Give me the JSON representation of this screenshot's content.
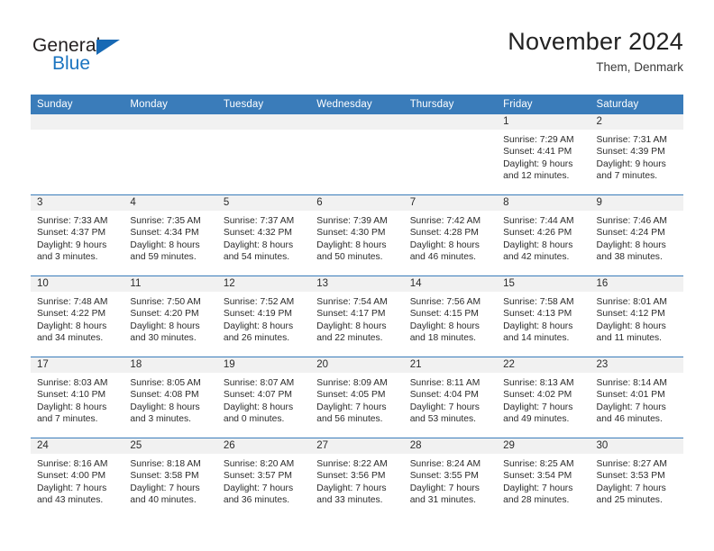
{
  "brand": {
    "name_part1": "General",
    "name_part2": "Blue",
    "accent_color": "#1b74c0",
    "triangle_icon": "triangle-icon"
  },
  "header": {
    "title": "November 2024",
    "subtitle": "Them, Denmark"
  },
  "calendar": {
    "header_bg": "#3a7cba",
    "daynum_bg": "#f1f1f1",
    "weekday_headers": [
      "Sunday",
      "Monday",
      "Tuesday",
      "Wednesday",
      "Thursday",
      "Friday",
      "Saturday"
    ],
    "weeks": [
      [
        {
          "day": "",
          "sunrise": "",
          "sunset": "",
          "daylight_line1": "",
          "daylight_line2": ""
        },
        {
          "day": "",
          "sunrise": "",
          "sunset": "",
          "daylight_line1": "",
          "daylight_line2": ""
        },
        {
          "day": "",
          "sunrise": "",
          "sunset": "",
          "daylight_line1": "",
          "daylight_line2": ""
        },
        {
          "day": "",
          "sunrise": "",
          "sunset": "",
          "daylight_line1": "",
          "daylight_line2": ""
        },
        {
          "day": "",
          "sunrise": "",
          "sunset": "",
          "daylight_line1": "",
          "daylight_line2": ""
        },
        {
          "day": "1",
          "sunrise": "Sunrise: 7:29 AM",
          "sunset": "Sunset: 4:41 PM",
          "daylight_line1": "Daylight: 9 hours",
          "daylight_line2": "and 12 minutes."
        },
        {
          "day": "2",
          "sunrise": "Sunrise: 7:31 AM",
          "sunset": "Sunset: 4:39 PM",
          "daylight_line1": "Daylight: 9 hours",
          "daylight_line2": "and 7 minutes."
        }
      ],
      [
        {
          "day": "3",
          "sunrise": "Sunrise: 7:33 AM",
          "sunset": "Sunset: 4:37 PM",
          "daylight_line1": "Daylight: 9 hours",
          "daylight_line2": "and 3 minutes."
        },
        {
          "day": "4",
          "sunrise": "Sunrise: 7:35 AM",
          "sunset": "Sunset: 4:34 PM",
          "daylight_line1": "Daylight: 8 hours",
          "daylight_line2": "and 59 minutes."
        },
        {
          "day": "5",
          "sunrise": "Sunrise: 7:37 AM",
          "sunset": "Sunset: 4:32 PM",
          "daylight_line1": "Daylight: 8 hours",
          "daylight_line2": "and 54 minutes."
        },
        {
          "day": "6",
          "sunrise": "Sunrise: 7:39 AM",
          "sunset": "Sunset: 4:30 PM",
          "daylight_line1": "Daylight: 8 hours",
          "daylight_line2": "and 50 minutes."
        },
        {
          "day": "7",
          "sunrise": "Sunrise: 7:42 AM",
          "sunset": "Sunset: 4:28 PM",
          "daylight_line1": "Daylight: 8 hours",
          "daylight_line2": "and 46 minutes."
        },
        {
          "day": "8",
          "sunrise": "Sunrise: 7:44 AM",
          "sunset": "Sunset: 4:26 PM",
          "daylight_line1": "Daylight: 8 hours",
          "daylight_line2": "and 42 minutes."
        },
        {
          "day": "9",
          "sunrise": "Sunrise: 7:46 AM",
          "sunset": "Sunset: 4:24 PM",
          "daylight_line1": "Daylight: 8 hours",
          "daylight_line2": "and 38 minutes."
        }
      ],
      [
        {
          "day": "10",
          "sunrise": "Sunrise: 7:48 AM",
          "sunset": "Sunset: 4:22 PM",
          "daylight_line1": "Daylight: 8 hours",
          "daylight_line2": "and 34 minutes."
        },
        {
          "day": "11",
          "sunrise": "Sunrise: 7:50 AM",
          "sunset": "Sunset: 4:20 PM",
          "daylight_line1": "Daylight: 8 hours",
          "daylight_line2": "and 30 minutes."
        },
        {
          "day": "12",
          "sunrise": "Sunrise: 7:52 AM",
          "sunset": "Sunset: 4:19 PM",
          "daylight_line1": "Daylight: 8 hours",
          "daylight_line2": "and 26 minutes."
        },
        {
          "day": "13",
          "sunrise": "Sunrise: 7:54 AM",
          "sunset": "Sunset: 4:17 PM",
          "daylight_line1": "Daylight: 8 hours",
          "daylight_line2": "and 22 minutes."
        },
        {
          "day": "14",
          "sunrise": "Sunrise: 7:56 AM",
          "sunset": "Sunset: 4:15 PM",
          "daylight_line1": "Daylight: 8 hours",
          "daylight_line2": "and 18 minutes."
        },
        {
          "day": "15",
          "sunrise": "Sunrise: 7:58 AM",
          "sunset": "Sunset: 4:13 PM",
          "daylight_line1": "Daylight: 8 hours",
          "daylight_line2": "and 14 minutes."
        },
        {
          "day": "16",
          "sunrise": "Sunrise: 8:01 AM",
          "sunset": "Sunset: 4:12 PM",
          "daylight_line1": "Daylight: 8 hours",
          "daylight_line2": "and 11 minutes."
        }
      ],
      [
        {
          "day": "17",
          "sunrise": "Sunrise: 8:03 AM",
          "sunset": "Sunset: 4:10 PM",
          "daylight_line1": "Daylight: 8 hours",
          "daylight_line2": "and 7 minutes."
        },
        {
          "day": "18",
          "sunrise": "Sunrise: 8:05 AM",
          "sunset": "Sunset: 4:08 PM",
          "daylight_line1": "Daylight: 8 hours",
          "daylight_line2": "and 3 minutes."
        },
        {
          "day": "19",
          "sunrise": "Sunrise: 8:07 AM",
          "sunset": "Sunset: 4:07 PM",
          "daylight_line1": "Daylight: 8 hours",
          "daylight_line2": "and 0 minutes."
        },
        {
          "day": "20",
          "sunrise": "Sunrise: 8:09 AM",
          "sunset": "Sunset: 4:05 PM",
          "daylight_line1": "Daylight: 7 hours",
          "daylight_line2": "and 56 minutes."
        },
        {
          "day": "21",
          "sunrise": "Sunrise: 8:11 AM",
          "sunset": "Sunset: 4:04 PM",
          "daylight_line1": "Daylight: 7 hours",
          "daylight_line2": "and 53 minutes."
        },
        {
          "day": "22",
          "sunrise": "Sunrise: 8:13 AM",
          "sunset": "Sunset: 4:02 PM",
          "daylight_line1": "Daylight: 7 hours",
          "daylight_line2": "and 49 minutes."
        },
        {
          "day": "23",
          "sunrise": "Sunrise: 8:14 AM",
          "sunset": "Sunset: 4:01 PM",
          "daylight_line1": "Daylight: 7 hours",
          "daylight_line2": "and 46 minutes."
        }
      ],
      [
        {
          "day": "24",
          "sunrise": "Sunrise: 8:16 AM",
          "sunset": "Sunset: 4:00 PM",
          "daylight_line1": "Daylight: 7 hours",
          "daylight_line2": "and 43 minutes."
        },
        {
          "day": "25",
          "sunrise": "Sunrise: 8:18 AM",
          "sunset": "Sunset: 3:58 PM",
          "daylight_line1": "Daylight: 7 hours",
          "daylight_line2": "and 40 minutes."
        },
        {
          "day": "26",
          "sunrise": "Sunrise: 8:20 AM",
          "sunset": "Sunset: 3:57 PM",
          "daylight_line1": "Daylight: 7 hours",
          "daylight_line2": "and 36 minutes."
        },
        {
          "day": "27",
          "sunrise": "Sunrise: 8:22 AM",
          "sunset": "Sunset: 3:56 PM",
          "daylight_line1": "Daylight: 7 hours",
          "daylight_line2": "and 33 minutes."
        },
        {
          "day": "28",
          "sunrise": "Sunrise: 8:24 AM",
          "sunset": "Sunset: 3:55 PM",
          "daylight_line1": "Daylight: 7 hours",
          "daylight_line2": "and 31 minutes."
        },
        {
          "day": "29",
          "sunrise": "Sunrise: 8:25 AM",
          "sunset": "Sunset: 3:54 PM",
          "daylight_line1": "Daylight: 7 hours",
          "daylight_line2": "and 28 minutes."
        },
        {
          "day": "30",
          "sunrise": "Sunrise: 8:27 AM",
          "sunset": "Sunset: 3:53 PM",
          "daylight_line1": "Daylight: 7 hours",
          "daylight_line2": "and 25 minutes."
        }
      ]
    ]
  }
}
